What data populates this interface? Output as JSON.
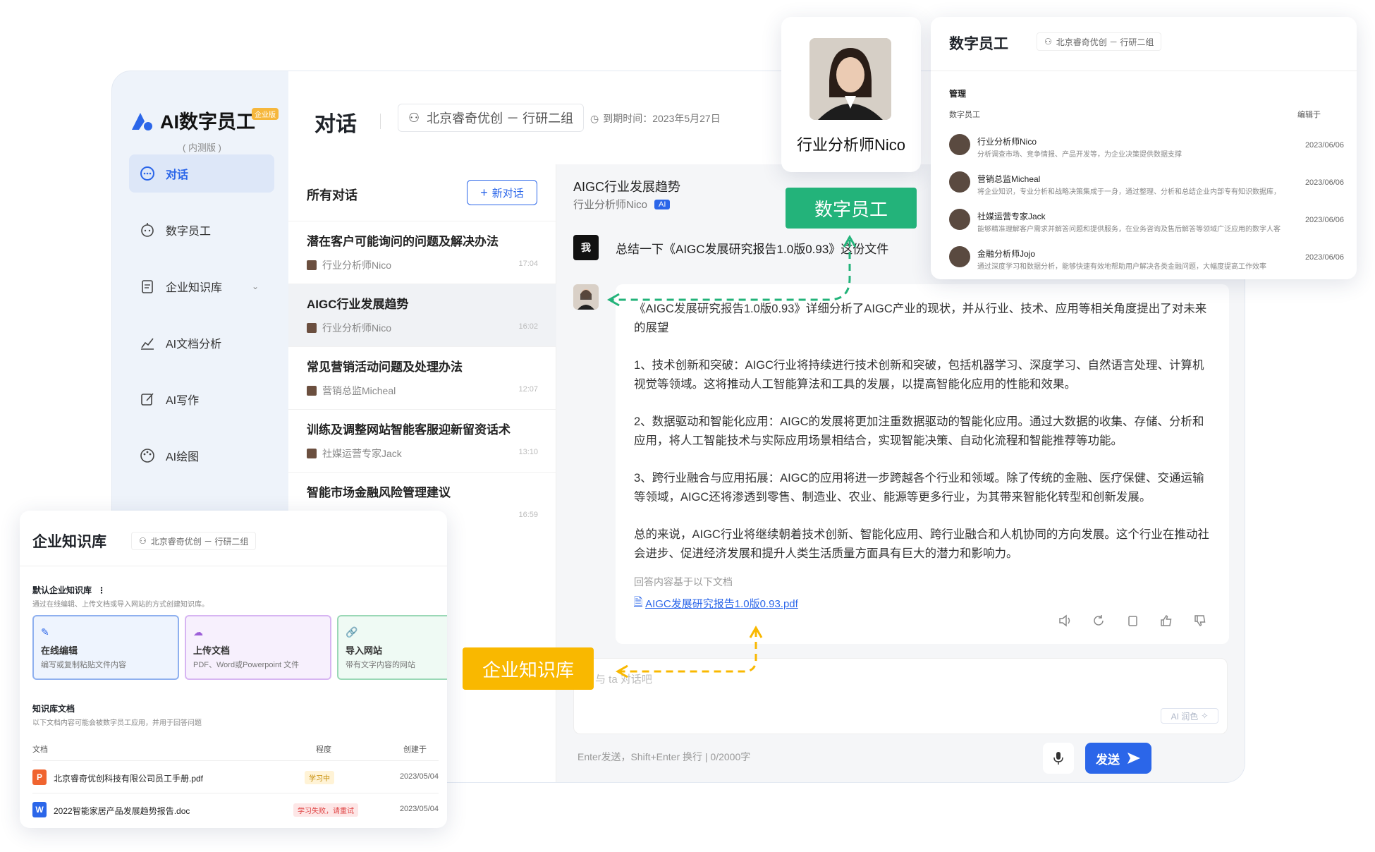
{
  "app": {
    "name": "AI数字员工",
    "badge": "企业版",
    "subtitle": "( 内测版 )"
  },
  "sidebar": {
    "items": [
      {
        "label": "对话",
        "icon": "chat-icon"
      },
      {
        "label": "数字员工",
        "icon": "robot-icon"
      },
      {
        "label": "企业知识库",
        "icon": "document-icon"
      },
      {
        "label": "AI文档分析",
        "icon": "chart-icon"
      },
      {
        "label": "AI写作",
        "icon": "edit-icon"
      },
      {
        "label": "AI绘图",
        "icon": "palette-icon"
      }
    ]
  },
  "topbar": {
    "title": "对话",
    "team": "北京睿奇优创 － 行研二组",
    "expire": "到期时间：2023年5月27日"
  },
  "conversations": {
    "header": "所有对话",
    "new_label": "新对话",
    "items": [
      {
        "title": "潜在客户可能询问的问题及解决办法",
        "who": "行业分析师Nico",
        "time": "17:04"
      },
      {
        "title": "AIGC行业发展趋势",
        "who": "行业分析师Nico",
        "time": "16:02"
      },
      {
        "title": "常见营销活动问题及处理办法",
        "who": "营销总监Micheal",
        "time": "12:07"
      },
      {
        "title": "训练及调整网站智能客服迎新留资话术",
        "who": "社媒运营专家Jack",
        "time": "13:10"
      },
      {
        "title": "智能市场金融风险管理建议",
        "who": "",
        "time": "16:59"
      }
    ]
  },
  "chat": {
    "title": "AIGC行业发展趋势",
    "sub": "行业分析师Nico",
    "ai_tag": "AI",
    "me_label": "我",
    "me_msg": "总结一下《AIGC发展研究报告1.0版0.93》这份文件",
    "answer": [
      "《AIGC发展研究报告1.0版0.93》详细分析了AIGC产业的现状，并从行业、技术、应用等相关角度提出了对未来的展望",
      "1、技术创新和突破：AIGC行业将持续进行技术创新和突破，包括机器学习、深度学习、自然语言处理、计算机视觉等领域。这将推动人工智能算法和工具的发展，以提高智能化应用的性能和效果。",
      "2、数据驱动和智能化应用：AIGC的发展将更加注重数据驱动的智能化应用。通过大数据的收集、存储、分析和应用，将人工智能技术与实际应用场景相结合，实现智能决策、自动化流程和智能推荐等功能。",
      "3、跨行业融合与应用拓展：AIGC的应用将进一步跨越各个行业和领域。除了传统的金融、医疗保健、交通运输等领域，AIGC还将渗透到零售、制造业、农业、能源等更多行业，为其带来智能化转型和创新发展。",
      "总的来说，AIGC行业将继续朝着技术创新、智能化应用、跨行业融合和人机协同的方向发展。这个行业在推动社会进步、促进经济发展和提升人类生活质量方面具有巨大的潜力和影响力。"
    ],
    "ref_label": "回答内容基于以下文档",
    "ref_file": "AIGC发展研究报告1.0版0.93.pdf",
    "input_placeholder": "与 ta 对话吧",
    "ai_rewrite": "AI 润色",
    "hint": "Enter发送，Shift+Enter 换行    |    0/2000字",
    "send": "发送"
  },
  "profile": {
    "name": "行业分析师Nico"
  },
  "labels": {
    "digital_employee": "数字员工",
    "knowledge_base": "企业知识库"
  },
  "emp_panel": {
    "title": "数字员工",
    "team": "北京睿奇优创 － 行研二组",
    "section": "管理",
    "col1": "数字员工",
    "col2": "编辑于",
    "rows": [
      {
        "name": "行业分析师Nico",
        "desc": "分析调查市场、竞争情报、产品开发等，为企业决策提供数据支撑",
        "date": "2023/06/06"
      },
      {
        "name": "营销总监Micheal",
        "desc": "将企业知识，专业分析和战略决策集成于一身，通过整理、分析和总结企业内部专有知识数据库，帮...",
        "date": "2023/06/06"
      },
      {
        "name": "社媒运营专家Jack",
        "desc": "能够精准理解客户需求并解答问题和提供服务，在业务咨询及售后解答等领域广泛应用的数字人客服",
        "date": "2023/06/06"
      },
      {
        "name": "金融分析师Jojo",
        "desc": "通过深度学习和数据分析，能够快速有效地帮助用户解决各类金融问题，大幅度提高工作效率",
        "date": "2023/06/06"
      }
    ]
  },
  "kb_panel": {
    "title": "企业知识库",
    "team": "北京睿奇优创 － 行研二组",
    "default": "默认企业知识库",
    "default_sub": "通过在线编辑、上传文档或导入网站的方式创建知识库。",
    "options": [
      {
        "name": "在线编辑",
        "desc": "编写或复制粘贴文件内容"
      },
      {
        "name": "上传文档",
        "desc": "PDF、Word或Powerpoint 文件"
      },
      {
        "name": "导入网站",
        "desc": "带有文字内容的网站"
      }
    ],
    "docs": "知识库文档",
    "docs_sub": "以下文档内容可能会被数字员工应用，并用于回答问题",
    "th": [
      "文档",
      "程度",
      "创建于"
    ],
    "rows": [
      {
        "icon": "P",
        "name": "北京睿奇优创科技有限公司员工手册.pdf",
        "status": "学习中",
        "date": "2023/05/04"
      },
      {
        "icon": "W",
        "name": "2022智能家居产品发展趋势报告.doc",
        "status": "学习失败，请重试",
        "date": "2023/05/04"
      }
    ]
  }
}
